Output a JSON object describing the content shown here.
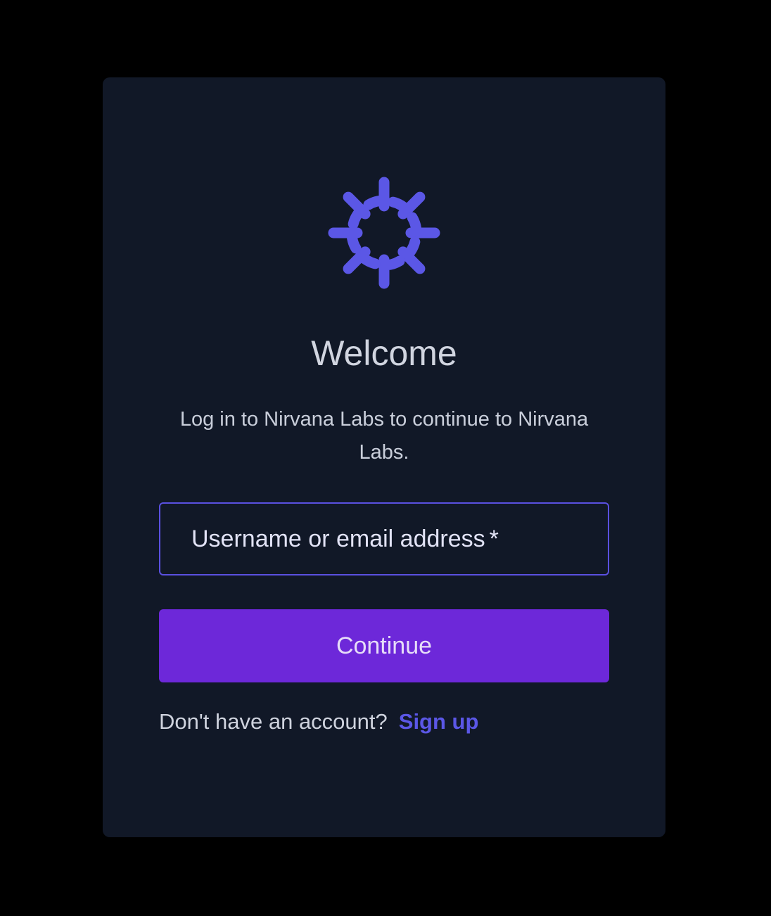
{
  "card": {
    "title": "Welcome",
    "subtitle": "Log in to Nirvana Labs to continue to Nirvana Labs."
  },
  "brand": {
    "logo_icon": "nirvana-labs-logo-icon",
    "accent_color": "#5b57e6"
  },
  "login_field": {
    "label": "Username or email address",
    "required_marker": "*",
    "value": "",
    "border_color": "#5a50e0"
  },
  "continue_button": {
    "label": "Continue",
    "color": "#6d28d9"
  },
  "signup": {
    "prompt": "Don't have an account?",
    "link_label": "Sign up"
  }
}
